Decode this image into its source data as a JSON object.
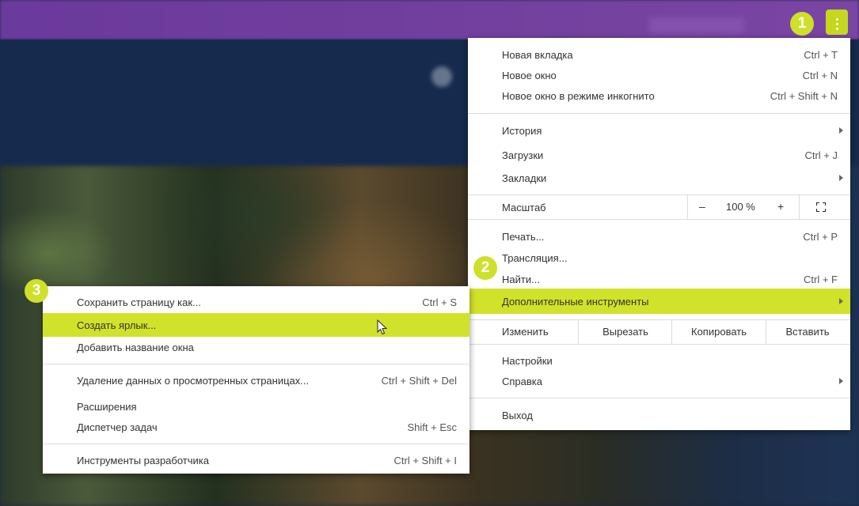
{
  "badges": {
    "one": "1",
    "two": "2",
    "three": "3"
  },
  "main_menu": {
    "new_tab": {
      "label": "Новая вкладка",
      "shortcut": "Ctrl + T"
    },
    "new_window": {
      "label": "Новое окно",
      "shortcut": "Ctrl + N"
    },
    "incognito": {
      "label": "Новое окно в режиме инкогнито",
      "shortcut": "Ctrl + Shift + N"
    },
    "history": {
      "label": "История"
    },
    "downloads": {
      "label": "Загрузки",
      "shortcut": "Ctrl + J"
    },
    "bookmarks": {
      "label": "Закладки"
    },
    "zoom": {
      "label": "Масштаб",
      "minus": "–",
      "value": "100 %",
      "plus": "+"
    },
    "print": {
      "label": "Печать...",
      "shortcut": "Ctrl + P"
    },
    "cast": {
      "label": "Трансляция..."
    },
    "find": {
      "label": "Найти...",
      "shortcut": "Ctrl + F"
    },
    "more_tools": {
      "label": "Дополнительные инструменты"
    },
    "edit": {
      "label": "Изменить",
      "cut": "Вырезать",
      "copy": "Копировать",
      "paste": "Вставить"
    },
    "settings": {
      "label": "Настройки"
    },
    "help": {
      "label": "Справка"
    },
    "exit": {
      "label": "Выход"
    }
  },
  "sub_menu": {
    "save_page": {
      "label": "Сохранить страницу как...",
      "shortcut": "Ctrl + S"
    },
    "create_shortcut": {
      "label": "Создать ярлык..."
    },
    "name_window": {
      "label": "Добавить название окна"
    },
    "clear_data": {
      "label": "Удаление данных о просмотренных страницах...",
      "shortcut": "Ctrl + Shift + Del"
    },
    "extensions": {
      "label": "Расширения"
    },
    "task_manager": {
      "label": "Диспетчер задач",
      "shortcut": "Shift + Esc"
    },
    "dev_tools": {
      "label": "Инструменты разработчика",
      "shortcut": "Ctrl + Shift + I"
    }
  },
  "colors": {
    "highlight": "#d1e22a",
    "badge": "#cfe02a",
    "title_bar": "#6a3a9c"
  },
  "icons": [
    "kebab-menu-icon",
    "submenu-arrow-icon",
    "fullscreen-icon",
    "mouse-cursor-icon"
  ]
}
